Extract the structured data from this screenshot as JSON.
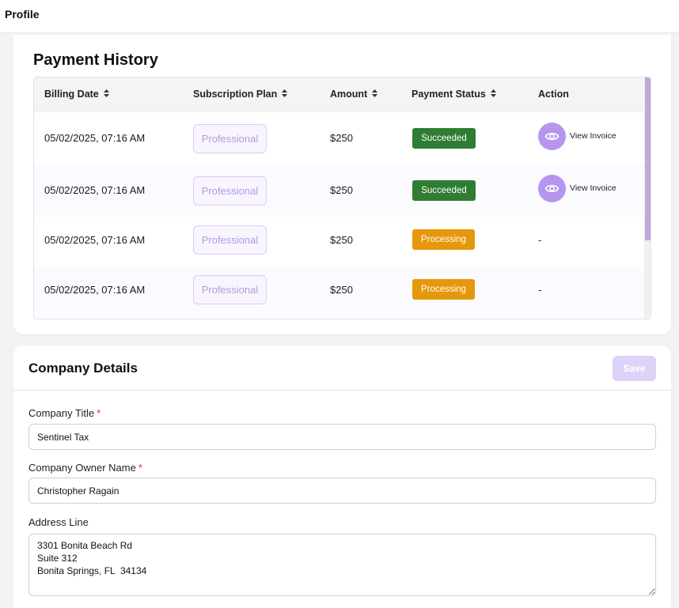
{
  "header": {
    "title": "Profile"
  },
  "payment_history": {
    "title": "Payment History",
    "columns": [
      "Billing Date",
      "Subscription Plan",
      "Amount",
      "Payment Status",
      "Action"
    ],
    "rows": [
      {
        "date": "05/02/2025, 07:16 AM",
        "plan": "Professional",
        "amount": "$250",
        "status": "Succeeded",
        "action": "View Invoice"
      },
      {
        "date": "05/02/2025, 07:16 AM",
        "plan": "Professional",
        "amount": "$250",
        "status": "Succeeded",
        "action": "View Invoice"
      },
      {
        "date": "05/02/2025, 07:16 AM",
        "plan": "Professional",
        "amount": "$250",
        "status": "Processing",
        "action": "-"
      },
      {
        "date": "05/02/2025, 07:16 AM",
        "plan": "Professional",
        "amount": "$250",
        "status": "Processing",
        "action": "-"
      }
    ],
    "colors": {
      "succeeded": "#2e7d32",
      "processing": "#e5980b",
      "accent": "#b795ef"
    }
  },
  "company": {
    "title": "Company Details",
    "save_label": "Save",
    "required_mark": "*",
    "fields": {
      "company_title": {
        "label": "Company Title",
        "value": "Sentinel Tax"
      },
      "owner_name": {
        "label": "Company Owner Name",
        "value": "Christopher Ragain"
      },
      "address": {
        "label": "Address Line",
        "value": "3301 Bonita Beach Rd\nSuite 312\nBonita Springs, FL  34134"
      }
    }
  },
  "icons": {
    "sort": "sort-arrows-icon",
    "view": "eye-icon"
  }
}
